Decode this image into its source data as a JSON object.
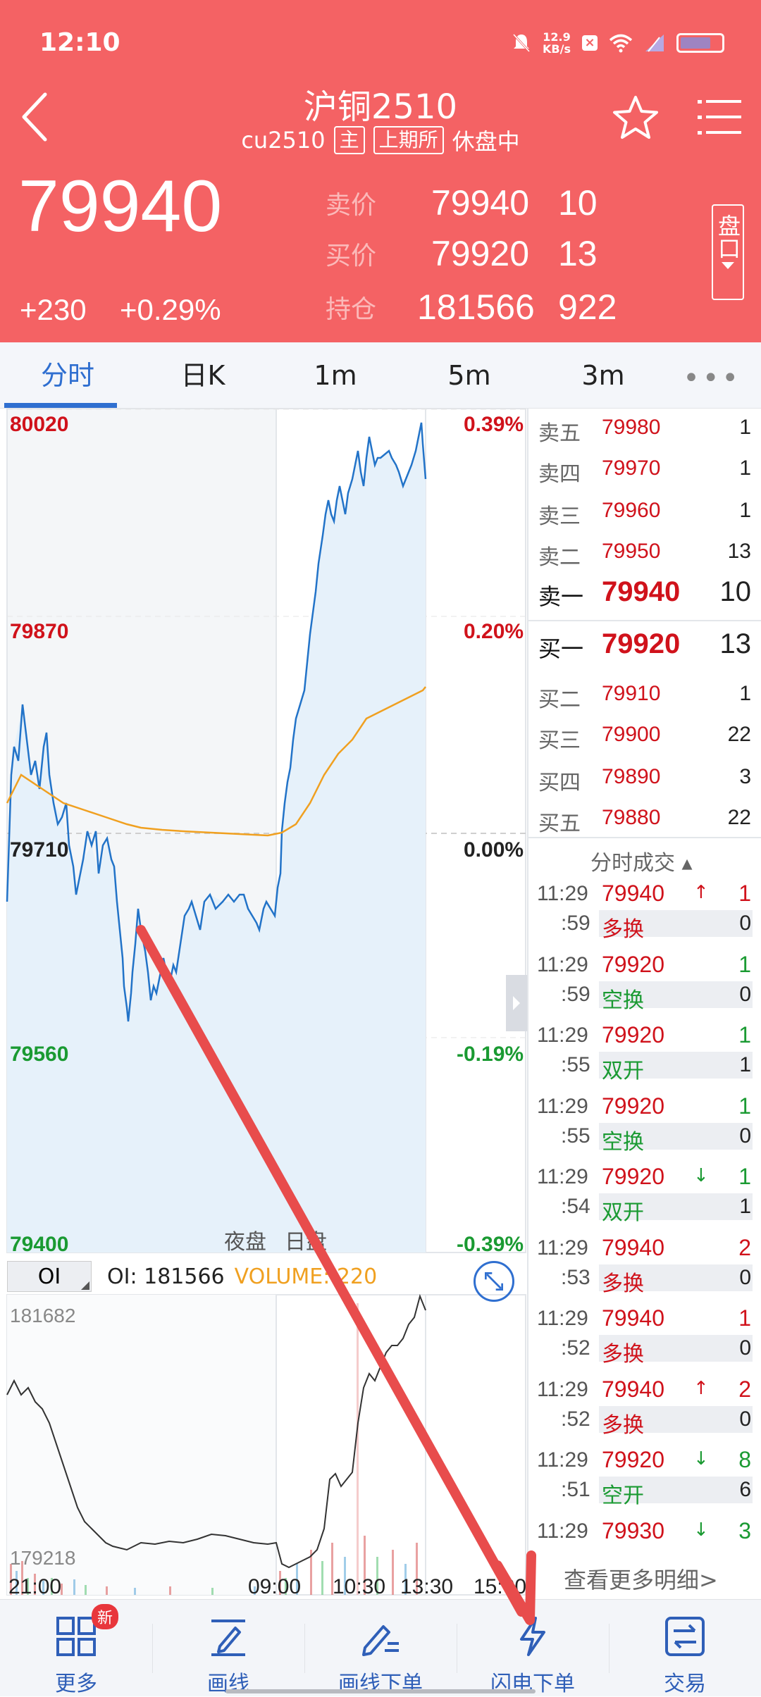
{
  "status_bar": {
    "time": "12:10",
    "net_speed_value": "12.9",
    "net_speed_unit": "KB/s"
  },
  "header": {
    "title": "沪铜2510",
    "symbol": "cu2510",
    "tag_main": "主",
    "exchange": "上期所",
    "state": "休盘中",
    "last_price": "79940",
    "change": "+230",
    "change_pct": "+0.29%",
    "ask_label": "卖价",
    "ask_price": "79940",
    "ask_vol": "10",
    "bid_label": "买价",
    "bid_price": "79920",
    "bid_vol": "13",
    "oi_label": "持仓",
    "oi_value": "181566",
    "oi_change": "922",
    "pankou_label": "盘口"
  },
  "tabs": [
    "分时",
    "日K",
    "1m",
    "5m",
    "3m"
  ],
  "tabs_more": "•••",
  "chart_labels": {
    "price_top": "80020",
    "price_2": "79870",
    "price_mid": "79710",
    "price_4": "79560",
    "price_bottom": "79400",
    "pct_top": "0.39%",
    "pct_2": "0.20%",
    "pct_mid": "0.00%",
    "pct_4": "-0.19%",
    "pct_bottom": "-0.39%",
    "session_night": "夜盘",
    "session_day": "日盘",
    "oi_select": "OI",
    "oi_text": "OI: 181566",
    "volume_text": "VOLUME: 220",
    "oi_max": "181682",
    "oi_min": "179218",
    "time_axis": [
      "21:00",
      "09:00",
      "10:30",
      "13:30",
      "15:00"
    ]
  },
  "chart_data": {
    "type": "line",
    "ylim": [
      79400,
      80020
    ],
    "prev_close": 79710,
    "series": []
  },
  "order_book": {
    "asks": [
      {
        "label": "卖五",
        "price": "79980",
        "vol": "1"
      },
      {
        "label": "卖四",
        "price": "79970",
        "vol": "1"
      },
      {
        "label": "卖三",
        "price": "79960",
        "vol": "1"
      },
      {
        "label": "卖二",
        "price": "79950",
        "vol": "13"
      },
      {
        "label": "卖一",
        "price": "79940",
        "vol": "10"
      }
    ],
    "bids": [
      {
        "label": "买一",
        "price": "79920",
        "vol": "13"
      },
      {
        "label": "买二",
        "price": "79910",
        "vol": "1"
      },
      {
        "label": "买三",
        "price": "79900",
        "vol": "22"
      },
      {
        "label": "买四",
        "price": "79890",
        "vol": "3"
      },
      {
        "label": "买五",
        "price": "79880",
        "vol": "22"
      }
    ]
  },
  "ticks_title": "分时成交 ▴",
  "ticks": [
    {
      "time": "11:29",
      "sec": ":59",
      "price": "79940",
      "arrow": "↑",
      "arrow_color": "#d0121b",
      "vol": "1",
      "vol_color": "#d0121b",
      "type": "多换",
      "type_color": "#d0121b",
      "oi": "0"
    },
    {
      "time": "11:29",
      "sec": ":59",
      "price": "79920",
      "arrow": "",
      "arrow_color": "#1a9a32",
      "vol": "1",
      "vol_color": "#1a9a32",
      "type": "空换",
      "type_color": "#1a9a32",
      "oi": "0"
    },
    {
      "time": "11:29",
      "sec": ":55",
      "price": "79920",
      "arrow": "",
      "arrow_color": "#1a9a32",
      "vol": "1",
      "vol_color": "#1a9a32",
      "type": "双开",
      "type_color": "#1a9a32",
      "oi": "1"
    },
    {
      "time": "11:29",
      "sec": ":55",
      "price": "79920",
      "arrow": "",
      "arrow_color": "#1a9a32",
      "vol": "1",
      "vol_color": "#1a9a32",
      "type": "空换",
      "type_color": "#1a9a32",
      "oi": "0"
    },
    {
      "time": "11:29",
      "sec": ":54",
      "price": "79920",
      "arrow": "↓",
      "arrow_color": "#1a9a32",
      "vol": "1",
      "vol_color": "#1a9a32",
      "type": "双开",
      "type_color": "#1a9a32",
      "oi": "1"
    },
    {
      "time": "11:29",
      "sec": ":53",
      "price": "79940",
      "arrow": "",
      "arrow_color": "#d0121b",
      "vol": "2",
      "vol_color": "#d0121b",
      "type": "多换",
      "type_color": "#d0121b",
      "oi": "0"
    },
    {
      "time": "11:29",
      "sec": ":52",
      "price": "79940",
      "arrow": "",
      "arrow_color": "#d0121b",
      "vol": "1",
      "vol_color": "#d0121b",
      "type": "多换",
      "type_color": "#d0121b",
      "oi": "0"
    },
    {
      "time": "11:29",
      "sec": ":52",
      "price": "79940",
      "arrow": "↑",
      "arrow_color": "#d0121b",
      "vol": "2",
      "vol_color": "#d0121b",
      "type": "多换",
      "type_color": "#d0121b",
      "oi": "0"
    },
    {
      "time": "11:29",
      "sec": ":51",
      "price": "79920",
      "arrow": "↓",
      "arrow_color": "#1a9a32",
      "vol": "8",
      "vol_color": "#1a9a32",
      "type": "空开",
      "type_color": "#1a9a32",
      "oi": "6"
    },
    {
      "time": "11:29",
      "sec": "",
      "price": "79930",
      "arrow": "↓",
      "arrow_color": "#1a9a32",
      "vol": "3",
      "vol_color": "#1a9a32",
      "type": "",
      "type_color": "#1a9a32",
      "oi": ""
    }
  ],
  "more_detail": "查看更多明细>",
  "bottom_nav": [
    {
      "label": "更多",
      "icon": "grid-icon"
    },
    {
      "label": "画线",
      "icon": "pen-line-icon"
    },
    {
      "label": "画线下单",
      "icon": "pen-order-icon"
    },
    {
      "label": "闪电下单",
      "icon": "lightning-icon"
    },
    {
      "label": "交易",
      "icon": "trade-icon"
    }
  ],
  "new_badge": "新",
  "colors": {
    "header_bg": "#f46264",
    "accent_blue": "#2f6fd0",
    "up_red": "#d0121b",
    "down_green": "#1a9a32",
    "avg_line": "#f0a020",
    "annotation_arrow": "#e84c4c"
  }
}
